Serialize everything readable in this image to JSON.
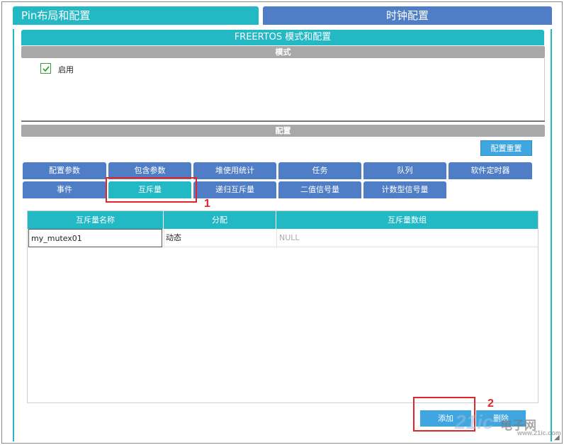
{
  "top_tabs": {
    "pin": "Pin布局和配置",
    "clock": "时钟配置"
  },
  "panel": {
    "title": "FREERTOS 模式和配置"
  },
  "mode": {
    "header": "模式",
    "enable_label": "启用",
    "enabled": true
  },
  "config": {
    "header": "配置",
    "reset_button": "配置重置",
    "tabs_row1": [
      "配置参数",
      "包含参数",
      "堆使用统计",
      "任务",
      "队列",
      "软件定时器"
    ],
    "tabs_row2": [
      "事件",
      "互斥量",
      "递归互斥量",
      "二值信号量",
      "计数型信号量"
    ],
    "active_tab": "互斥量"
  },
  "table": {
    "headers": [
      "互斥量名称",
      "分配",
      "互斥量数组"
    ],
    "rows": [
      {
        "name": "my_mutex01",
        "allocation": "动态",
        "array": "NULL"
      }
    ]
  },
  "buttons": {
    "add": "添加",
    "delete": "删除"
  },
  "annotations": {
    "step1": "1",
    "step2": "2"
  },
  "watermark": {
    "brand": "21ic",
    "cn": "电子网",
    "url": "www.21ic.com"
  },
  "colors": {
    "teal": "#22b8c4",
    "blue": "#4f7ec6",
    "button": "#3fa6e0",
    "highlight": "#e0262b"
  }
}
